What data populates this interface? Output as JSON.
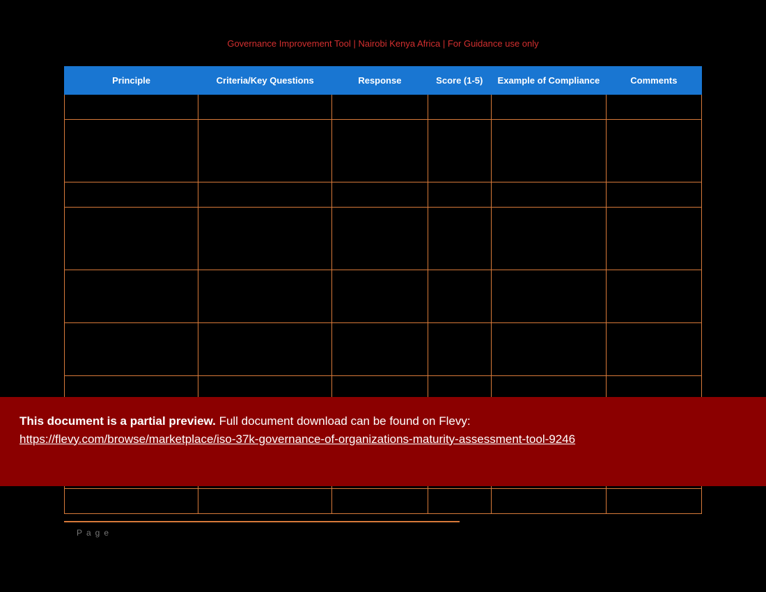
{
  "header": {
    "title": "Governance Improvement Tool | Nairobi Kenya Africa | For Guidance use only"
  },
  "table": {
    "columns": [
      "Principle",
      "Criteria/Key Questions",
      "Response",
      "Score (1-5)",
      "Example of Compliance",
      "Comments"
    ]
  },
  "footer": {
    "page_label": "Page"
  },
  "overlay": {
    "bold_text": "This document is a partial preview.",
    "rest_text": "  Full document download can be found on Flevy:",
    "link_text": "https://flevy.com/browse/marketplace/iso-37k-governance-of-organizations-maturity-assessment-tool-9246"
  }
}
